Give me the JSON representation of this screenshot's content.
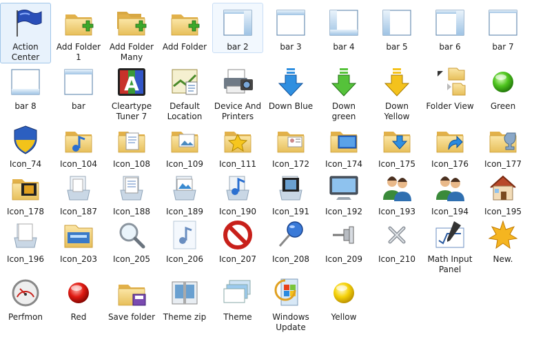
{
  "items": [
    {
      "label": "Action Center",
      "icon": "flag-icon"
    },
    {
      "label": "Add Folder 1",
      "icon": "folder-add-icon"
    },
    {
      "label": "Add Folder Many",
      "icon": "folder-add-many-icon"
    },
    {
      "label": "Add Folder",
      "icon": "folder-add-icon"
    },
    {
      "label": "bar 2",
      "icon": "window-bar-right-icon"
    },
    {
      "label": "bar 3",
      "icon": "window-bar-top-icon"
    },
    {
      "label": "bar 4",
      "icon": "window-bar-left-bottom-icon"
    },
    {
      "label": "bar 5",
      "icon": "window-bar-left-icon"
    },
    {
      "label": "bar 6",
      "icon": "window-bar-right-top-icon"
    },
    {
      "label": "bar 7",
      "icon": "window-bar-top-thin-icon"
    },
    {
      "label": "bar 8",
      "icon": "window-bar-bottom-icon"
    },
    {
      "label": "bar",
      "icon": "window-bar-top-icon"
    },
    {
      "label": "Cleartype Tuner 7",
      "icon": "cleartype-icon"
    },
    {
      "label": "Default Location",
      "icon": "default-location-icon"
    },
    {
      "label": "Device And Printers",
      "icon": "printer-icon"
    },
    {
      "label": "Down Blue",
      "icon": "arrow-down-blue-icon"
    },
    {
      "label": "Down green",
      "icon": "arrow-down-green-icon"
    },
    {
      "label": "Down Yellow",
      "icon": "arrow-down-yellow-icon"
    },
    {
      "label": "Folder View",
      "icon": "folder-view-icon"
    },
    {
      "label": "Green",
      "icon": "green-orb-icon"
    },
    {
      "label": "Icon_74",
      "icon": "shield-icon"
    },
    {
      "label": "Icon_104",
      "icon": "folder-music-icon"
    },
    {
      "label": "Icon_108",
      "icon": "folder-documents-icon"
    },
    {
      "label": "Icon_109",
      "icon": "folder-pictures-icon"
    },
    {
      "label": "Icon_111",
      "icon": "folder-star-icon"
    },
    {
      "label": "Icon_172",
      "icon": "folder-contacts-icon"
    },
    {
      "label": "Icon_174",
      "icon": "folder-desktop-icon"
    },
    {
      "label": "Icon_175",
      "icon": "folder-download-icon"
    },
    {
      "label": "Icon_176",
      "icon": "folder-shortcut-icon"
    },
    {
      "label": "Icon_177",
      "icon": "folder-games-icon"
    },
    {
      "label": "Icon_178",
      "icon": "folder-video-icon"
    },
    {
      "label": "Icon_187",
      "icon": "library-icon"
    },
    {
      "label": "Icon_188",
      "icon": "documents-library-icon"
    },
    {
      "label": "Icon_189",
      "icon": "pictures-library-icon"
    },
    {
      "label": "Icon_190",
      "icon": "music-library-icon"
    },
    {
      "label": "Icon_191",
      "icon": "videos-library-icon"
    },
    {
      "label": "Icon_192",
      "icon": "monitor-icon"
    },
    {
      "label": "Icon_193",
      "icon": "users-icon"
    },
    {
      "label": "Icon_194",
      "icon": "users-icon"
    },
    {
      "label": "Icon_195",
      "icon": "home-icon"
    },
    {
      "label": "Icon_196",
      "icon": "library-docs-icon"
    },
    {
      "label": "Icon_203",
      "icon": "explorer-icon"
    },
    {
      "label": "Icon_205",
      "icon": "magnifier-icon"
    },
    {
      "label": "Icon_206",
      "icon": "music-note-icon"
    },
    {
      "label": "Icon_207",
      "icon": "no-entry-icon"
    },
    {
      "label": "Icon_208",
      "icon": "pin-icon"
    },
    {
      "label": "Icon_209",
      "icon": "pin-side-icon"
    },
    {
      "label": "Icon_210",
      "icon": "close-x-icon"
    },
    {
      "label": "Math Input Panel",
      "icon": "math-input-icon"
    },
    {
      "label": "New.",
      "icon": "starburst-icon"
    },
    {
      "label": "Perfmon",
      "icon": "gauge-icon"
    },
    {
      "label": "Red",
      "icon": "red-orb-icon"
    },
    {
      "label": "Save folder",
      "icon": "save-folder-icon"
    },
    {
      "label": "Theme zip",
      "icon": "theme-zip-icon"
    },
    {
      "label": "Theme",
      "icon": "theme-icon"
    },
    {
      "label": "Windows Update",
      "icon": "windows-update-icon"
    },
    {
      "label": "Yellow",
      "icon": "yellow-orb-icon"
    }
  ]
}
